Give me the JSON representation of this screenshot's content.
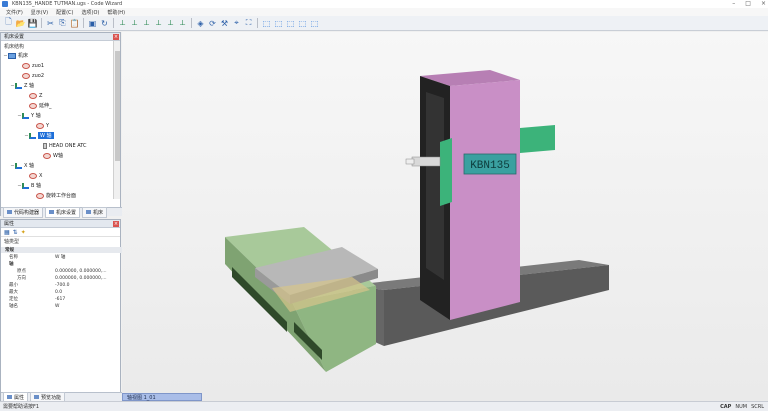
{
  "window": {
    "title": "KBN135_HANDE TUTMAN.ugs - Code Wizard"
  },
  "menu": [
    "文件(F)",
    "显示(V)",
    "配置(C)",
    "选项(O)",
    "帮助(H)"
  ],
  "toolbar_icons": [
    "new-icon",
    "open-icon",
    "save-icon",
    "sep",
    "cut-icon",
    "copy-icon",
    "paste-icon",
    "sep",
    "machine-icon",
    "refresh-icon",
    "sep",
    "axis-x-icon",
    "axis-y-icon",
    "axis-z-icon",
    "axis-a-icon",
    "axis-b-icon",
    "axis-c-icon",
    "sep",
    "component-icon",
    "rotate-icon",
    "tool-icon",
    "measure-icon",
    "fit-icon",
    "sep",
    "view-1-icon",
    "view-2-icon",
    "view-3-icon",
    "view-4-icon",
    "view-5-icon"
  ],
  "machine_tree": {
    "header": "机床设置",
    "root_label": "机床结构",
    "rows": [
      {
        "label": "机床",
        "icon": "machine",
        "indent": 0,
        "twisty": "−"
      },
      {
        "label": "zuo1",
        "icon": "component",
        "indent": 2
      },
      {
        "label": "zuo2",
        "icon": "component",
        "indent": 2
      },
      {
        "label": "Z 轴",
        "icon": "axis",
        "indent": 1,
        "twisty": "−"
      },
      {
        "label": "Z",
        "icon": "component",
        "indent": 3
      },
      {
        "label": "延伸_",
        "icon": "component",
        "indent": 3
      },
      {
        "label": "Y 轴",
        "icon": "axis",
        "indent": 2,
        "twisty": "−"
      },
      {
        "label": "Y",
        "icon": "component",
        "indent": 4
      },
      {
        "label": "W 轴",
        "icon": "axis",
        "indent": 3,
        "twisty": "−",
        "selected": true
      },
      {
        "label": "HEAD ONE ATC",
        "icon": "tool",
        "indent": 5
      },
      {
        "label": "W轴",
        "icon": "component",
        "indent": 5
      },
      {
        "label": "X 轴",
        "icon": "axis",
        "indent": 1,
        "twisty": "−"
      },
      {
        "label": "X",
        "icon": "component",
        "indent": 3
      },
      {
        "label": "B 轴",
        "icon": "axis",
        "indent": 2,
        "twisty": "−"
      },
      {
        "label": "旋转工作台面",
        "icon": "component",
        "indent": 4
      }
    ]
  },
  "left_tabs": [
    {
      "label": "代码构建器",
      "active": false
    },
    {
      "label": "机床设置",
      "active": true
    },
    {
      "label": "机床",
      "active": false
    }
  ],
  "properties": {
    "header": "属性",
    "type_label": "轴类型",
    "rows": [
      {
        "kind": "group",
        "key": "常规",
        "value": ""
      },
      {
        "kind": "row",
        "key": "名称",
        "value": "W 轴"
      },
      {
        "kind": "subgroup",
        "key": "轴",
        "value": ""
      },
      {
        "kind": "child",
        "key": "原点",
        "value": "0.000000, 0.000000,..."
      },
      {
        "kind": "child",
        "key": "方向",
        "value": "0.000000, 0.000000,..."
      },
      {
        "kind": "row",
        "key": "最小",
        "value": "-700.0"
      },
      {
        "kind": "row",
        "key": "最大",
        "value": "0.0"
      },
      {
        "kind": "row",
        "key": "定位",
        "value": "-617"
      },
      {
        "kind": "row",
        "key": "轴名",
        "value": "W"
      }
    ]
  },
  "bottom_tabs": [
    {
      "label": "属性",
      "active": true
    },
    {
      "label": "预览功能",
      "active": false
    }
  ],
  "viewport": {
    "view_tab": "轴视图 1_01",
    "machine_label": "KBN135"
  },
  "status": {
    "left": "需要帮助请按F1",
    "right": [
      "CAP",
      "NUM",
      "SCRL"
    ]
  },
  "colors": {
    "column": "#c98fc6",
    "base": "#6e6e6e",
    "bed": "#a8c99a",
    "table": "#b8b8b8",
    "spindle_head": "#3cb37a",
    "accent": "#1e6fd9"
  }
}
